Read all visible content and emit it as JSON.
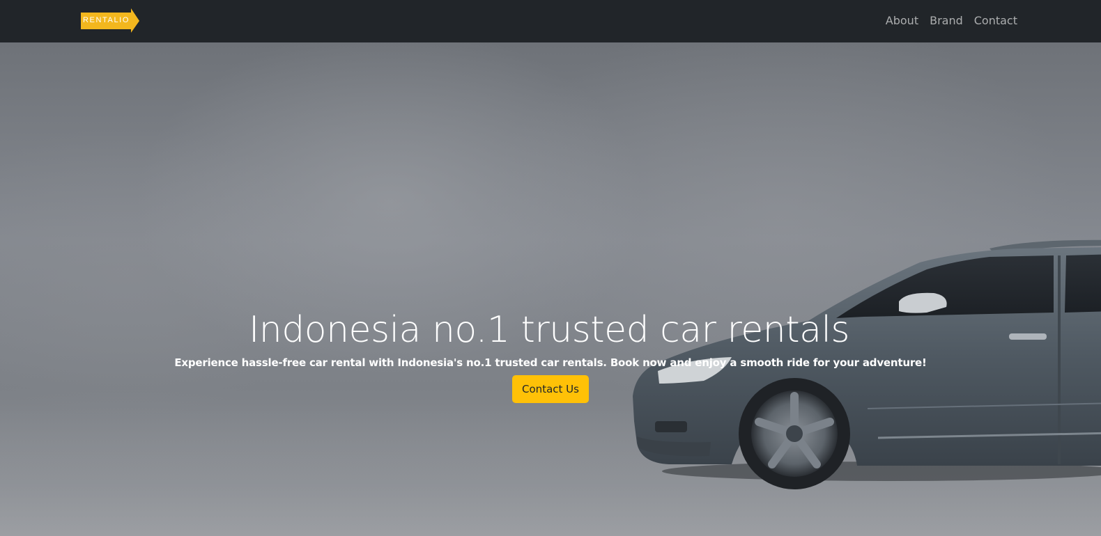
{
  "navbar": {
    "brand_text": "RENTALIO",
    "links": [
      {
        "label": "About"
      },
      {
        "label": "Brand"
      },
      {
        "label": "Contact"
      }
    ]
  },
  "hero": {
    "title": "Indonesia no.1 trusted car rentals",
    "subtitle": "Experience hassle-free car rental with Indonesia's no.1 trusted car rentals. Book now and enjoy a smooth ride for your adventure!",
    "cta_label": "Contact Us",
    "background_image": "silver-station-wagon-car-photo"
  },
  "colors": {
    "navbar_bg": "#212529",
    "accent": "#ffc107",
    "nav_link": "rgba(255,255,255,0.62)",
    "hero_text": "#ffffff"
  }
}
